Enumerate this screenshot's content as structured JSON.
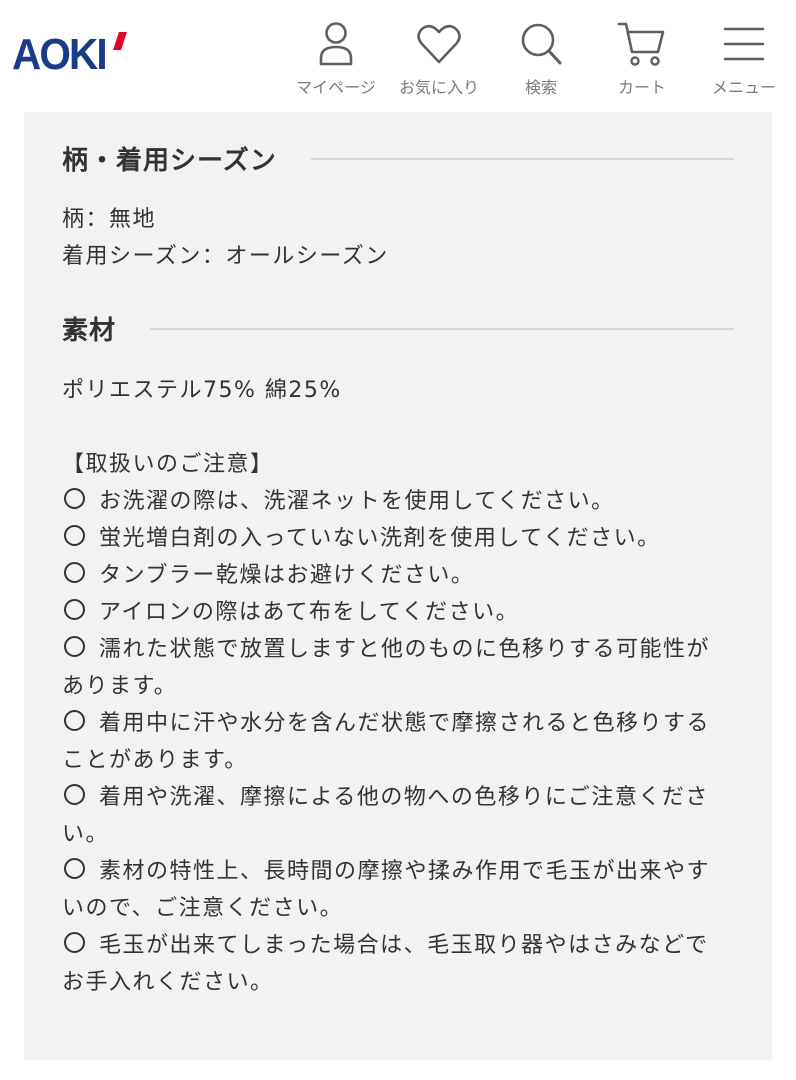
{
  "header": {
    "logo_text": "AOKI",
    "brand_colors": {
      "logo_blue": "#1a3a8a",
      "logo_red": "#e4002b"
    },
    "nav": [
      {
        "label": "マイページ",
        "icon": "person-icon"
      },
      {
        "label": "お気に入り",
        "icon": "heart-icon"
      },
      {
        "label": "検索",
        "icon": "search-icon"
      },
      {
        "label": "カート",
        "icon": "cart-icon"
      },
      {
        "label": "メニュー",
        "icon": "menu-icon"
      }
    ]
  },
  "pattern_section": {
    "title": "柄・着用シーズン",
    "pattern": "柄：無地",
    "season": "着用シーズン：オールシーズン"
  },
  "material_section": {
    "title": "素材",
    "composition": "ポリエステル75% 綿25%",
    "care_heading": "【取扱いのご注意】",
    "care_items": [
      "お洗濯の際は、洗濯ネットを使用してください。",
      "蛍光増白剤の入っていない洗剤を使用してください。",
      "タンブラー乾燥はお避けください。",
      "アイロンの際はあて布をしてください。",
      "濡れた状態で放置しますと他のものに色移りする可能性があります。",
      "着用中に汗や水分を含んだ状態で摩擦されると色移りすることがあります。",
      "着用や洗濯、摩擦による他の物への色移りにご注意ください。",
      "素材の特性上、長時間の摩擦や揉み作用で毛玉が出来やすいので、ご注意ください。",
      "毛玉が出来てしまった場合は、毛玉取り器やはさみなどでお手入れください。"
    ]
  }
}
